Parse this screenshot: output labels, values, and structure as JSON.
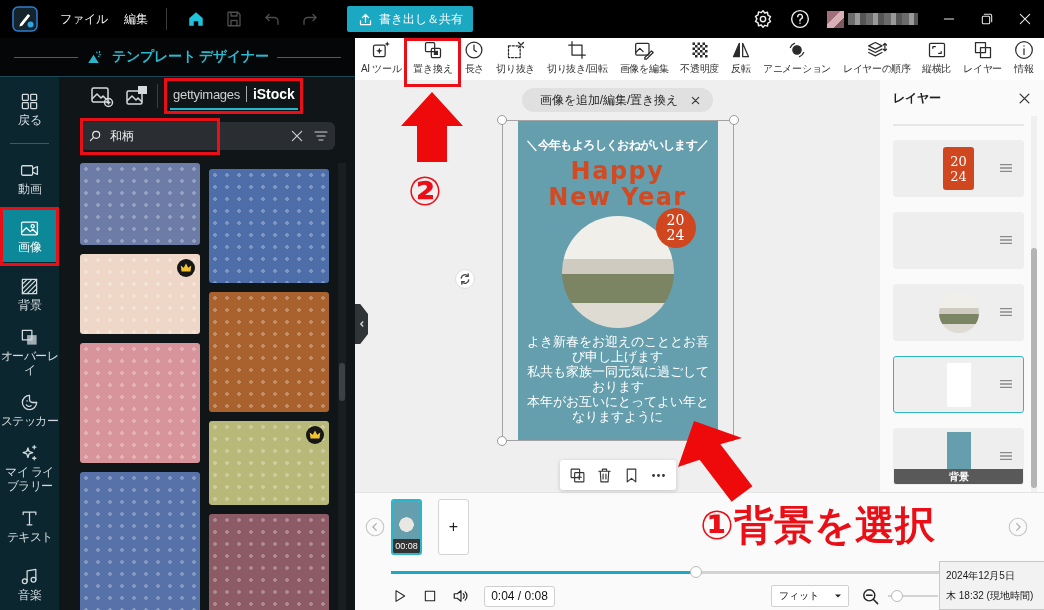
{
  "titlebar": {
    "menus": [
      "ファイル",
      "編集"
    ],
    "quick_actions": [
      {
        "kind": "home",
        "active": true,
        "disabled": false
      },
      {
        "kind": "save",
        "active": false,
        "disabled": true
      },
      {
        "kind": "undo",
        "active": false,
        "disabled": true
      },
      {
        "kind": "redo",
        "active": false,
        "disabled": true
      }
    ],
    "export_button": "書き出し＆共有"
  },
  "panel_header": {
    "title": "テンプレート デザイナー"
  },
  "nav": [
    {
      "label": "戻る",
      "selected": false
    },
    {
      "label": "動画",
      "selected": false
    },
    {
      "label": "画像",
      "selected": true
    },
    {
      "label": "背景",
      "selected": false
    },
    {
      "label": "オーバーレイ",
      "selected": false
    },
    {
      "label": "ステッカー",
      "selected": false
    },
    {
      "label": "マイ ライブラリー",
      "selected": false
    },
    {
      "label": "テキスト",
      "selected": false
    },
    {
      "label": "音楽",
      "selected": false
    }
  ],
  "source_tabs": [
    {
      "kind": "upload",
      "selected": false
    },
    {
      "kind": "library",
      "selected": false
    },
    {
      "kind": "stock",
      "labels": [
        "gettyimages",
        "iStock"
      ],
      "selected": true
    }
  ],
  "search": {
    "value": "和柄"
  },
  "image_results": {
    "columns": [
      {
        "tiles": [
          {
            "color": "#6c7ca6",
            "premium": false
          },
          {
            "color": "#eed7c6",
            "premium": true
          },
          {
            "color": "#d8949b",
            "premium": false
          },
          {
            "color": "#5672a9",
            "premium": false
          }
        ]
      },
      {
        "tiles": [
          {
            "color": "#4d6ea8",
            "premium": false
          },
          {
            "color": "#a9622e",
            "premium": false
          },
          {
            "color": "#b8b879",
            "premium": true
          },
          {
            "color": "#8d5b65",
            "premium": false
          }
        ]
      }
    ]
  },
  "tools": [
    {
      "label": "AI ツール"
    },
    {
      "label": "置き換え"
    },
    {
      "label": "長さ"
    },
    {
      "label": "切り抜き"
    },
    {
      "label": "切り抜き/回転"
    },
    {
      "label": "画像を編集"
    },
    {
      "label": "不透明度"
    },
    {
      "label": "反転"
    },
    {
      "label": "アニメーション"
    },
    {
      "label": "レイヤーの順序"
    }
  ],
  "view_tools": [
    {
      "label": "縦横比"
    },
    {
      "label": "レイヤー"
    },
    {
      "label": "情報"
    }
  ],
  "canvas": {
    "hint": "画像を追加/編集/置き換え",
    "card": {
      "greeting": "＼今年もよろしくおねがいします／",
      "title_lines": [
        "Happy",
        "New Year"
      ],
      "badge_lines": [
        "20",
        "24"
      ],
      "message_lines": [
        "よき新春をお迎えのこととお喜び申し上げます",
        "私共も家族一同元気に過ごしております",
        "本年がお互いにとってよい年となりますように"
      ]
    }
  },
  "layers": {
    "title": "レイヤー",
    "items": [
      {
        "kind": "badge",
        "lines": [
          "20",
          "24"
        ],
        "selected": false
      },
      {
        "kind": "empty",
        "selected": false
      },
      {
        "kind": "photo",
        "selected": false
      },
      {
        "kind": "frame",
        "selected": true
      },
      {
        "kind": "background",
        "label": "背景",
        "selected": false
      }
    ]
  },
  "timeline": {
    "clips": [
      {
        "duration": "00:08",
        "selected": true
      }
    ],
    "add_label": "+",
    "progress": {
      "level": 0.5
    },
    "time": "0:04 / 0:08",
    "zoom_mode": "フィット",
    "zoom": {
      "level": 0.05
    }
  },
  "date_tooltip": {
    "lines": [
      "2024年12月5日",
      "木 18:32 (現地時間)"
    ]
  },
  "callouts": [
    {
      "text": "②"
    },
    {
      "text": "①背景を選択"
    }
  ]
}
